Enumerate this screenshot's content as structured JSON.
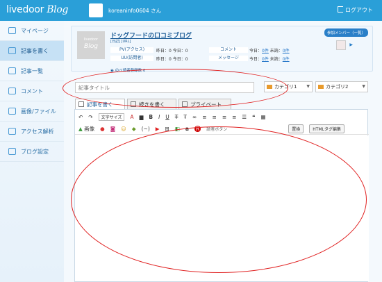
{
  "header": {
    "brand_main": "livedoor",
    "brand_blog": "Blog",
    "username": "koreaninfo0604 さん",
    "logout_label": "ログアウト"
  },
  "sidebar": {
    "items": [
      {
        "label": "マイページ",
        "icon": "home-icon"
      },
      {
        "label": "記事を書く",
        "icon": "pencil-icon",
        "active": true
      },
      {
        "label": "記事一覧",
        "icon": "document-list-icon"
      },
      {
        "label": "コメント",
        "icon": "comment-icon"
      },
      {
        "label": "画像/ファイル",
        "icon": "image-icon"
      },
      {
        "label": "アクセス解析",
        "icon": "chart-icon"
      },
      {
        "label": "ブログ設定",
        "icon": "wrench-icon"
      }
    ]
  },
  "blog": {
    "thumb_small": "livedoor",
    "thumb_big": "Blog",
    "title": "ドッグフードの口コミブログ",
    "links": "[日記] [URL]",
    "pv_label": "PV(アクセス)",
    "pv_value": "昨日：0 今日：0",
    "uu_label": "UU(訪問者)",
    "uu_value": "昨日：0 今日：0",
    "comment_label": "コメント",
    "comment_value": "今日：",
    "comment_today": "0件",
    "comment_unread_label": " 未読：",
    "comment_unread": "0件",
    "message_label": "メッセージ",
    "message_value": "今日：",
    "message_today": "0件",
    "message_unread_label": " 未読：",
    "message_unread": "0件",
    "rss_label": "のべ読者登録数",
    "rss_value": "0",
    "join_button": "参加メンバー（一覧）"
  },
  "form": {
    "title_placeholder": "記事タイトル",
    "category1": "カテゴリ1",
    "category2": "カテゴリ2"
  },
  "tabs": [
    {
      "label": "記事を書く",
      "active": true
    },
    {
      "label": "続きを書く"
    },
    {
      "label": "プライベート"
    }
  ],
  "toolbar": {
    "font_size": "文字サイズ",
    "image_label": "画像",
    "emoji_label": "(~)",
    "read_more": "読者ボタン",
    "replace": "置換",
    "html_edit": "HTMLタグ編集"
  },
  "colors": {
    "header": "#2a9fd8",
    "accent": "#1a5b96",
    "annotation": "#e02020"
  }
}
